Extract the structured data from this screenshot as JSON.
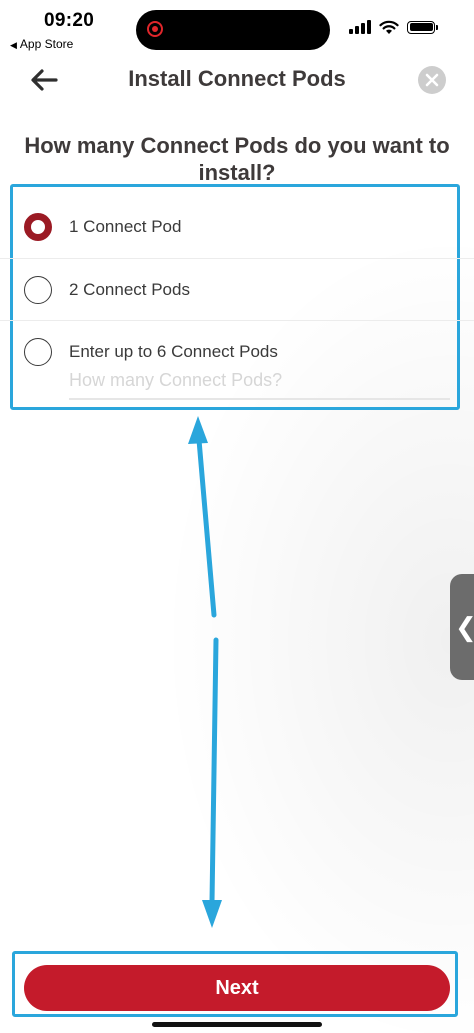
{
  "status_bar": {
    "time": "09:20",
    "back_app": "App Store",
    "icons": [
      "cellular-signal-icon",
      "wifi-icon",
      "battery-icon"
    ]
  },
  "header": {
    "title": "Install Connect Pods",
    "back_icon": "arrow-left-icon",
    "close_icon": "close-icon"
  },
  "question": "How many Connect Pods do you want to install?",
  "options": [
    {
      "label": "1 Connect Pod",
      "selected": true
    },
    {
      "label": "2 Connect Pods",
      "selected": false
    },
    {
      "label": "Enter up to 6 Connect Pods",
      "selected": false
    }
  ],
  "pods_input": {
    "value": "",
    "placeholder": "How many Connect Pods?"
  },
  "side_handle_icon": "chevron-left-icon",
  "next_label": "Next",
  "colors": {
    "accent_red": "#c41b2b",
    "radio_selected": "#9b1a24",
    "highlight_blue": "#2aa6dc"
  }
}
